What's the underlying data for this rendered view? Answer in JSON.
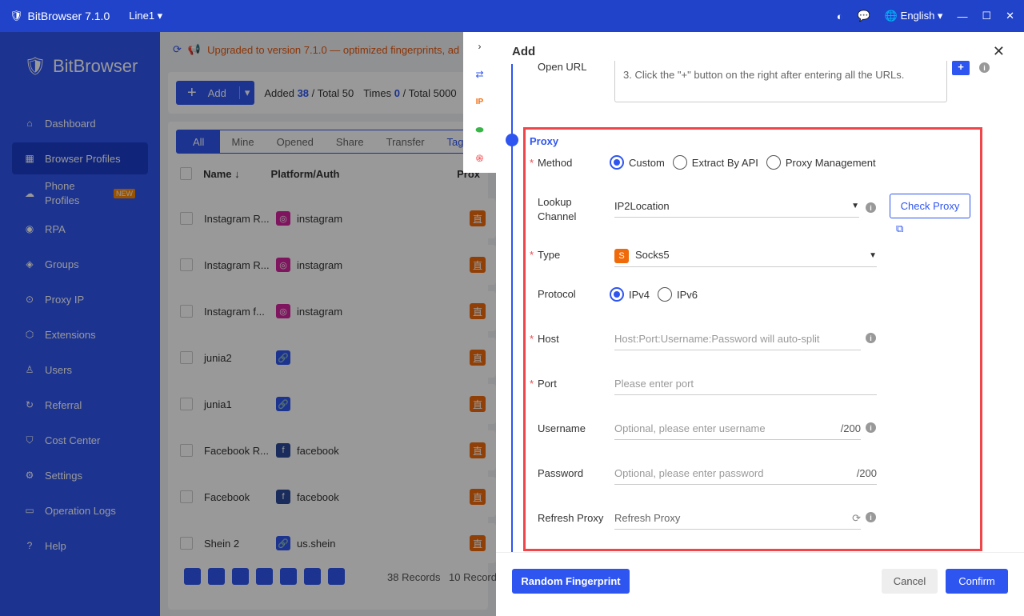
{
  "titlebar": {
    "app": "BitBrowser 7.1.0",
    "line": "Line1 ▾",
    "language": "English ▾"
  },
  "sidebar": {
    "logo": "BitBrowser",
    "items": [
      {
        "label": "Dashboard",
        "icon": "⌂"
      },
      {
        "label": "Browser Profiles",
        "icon": "▦"
      },
      {
        "label": "Phone Profiles",
        "icon": "☁",
        "badge": "NEW"
      },
      {
        "label": "RPA",
        "icon": "◉"
      },
      {
        "label": "Groups",
        "icon": "◈"
      },
      {
        "label": "Proxy IP",
        "icon": "⊙"
      },
      {
        "label": "Extensions",
        "icon": "⬡"
      },
      {
        "label": "Users",
        "icon": "♙"
      },
      {
        "label": "Referral",
        "icon": "↻"
      },
      {
        "label": "Cost Center",
        "icon": "⛉"
      },
      {
        "label": "Settings",
        "icon": "⚙"
      },
      {
        "label": "Operation Logs",
        "icon": "▭"
      },
      {
        "label": "Help",
        "icon": "?"
      }
    ]
  },
  "notice": "Upgraded to version 7.1.0 — optimized fingerprints, ad",
  "toolbar": {
    "add": "Add",
    "added_label": "Added",
    "added": "38",
    "total_label": "/ Total 50",
    "times_label": "Times",
    "times": "0",
    "times_total": "/ Total 5000"
  },
  "tabs": [
    "All",
    "Mine",
    "Opened",
    "Share",
    "Transfer",
    "Tags"
  ],
  "columns": {
    "name": "Name ↓",
    "platform": "Platform/Auth",
    "proxy": "Prox"
  },
  "rows": [
    {
      "name": "Instagram R...",
      "platform": "instagram",
      "type": "ig"
    },
    {
      "name": "Instagram R...",
      "platform": "instagram",
      "type": "ig"
    },
    {
      "name": "Instagram f...",
      "platform": "instagram",
      "type": "ig"
    },
    {
      "name": "junia2",
      "platform": "",
      "type": "link"
    },
    {
      "name": "junia1",
      "platform": "",
      "type": "link"
    },
    {
      "name": "Facebook R...",
      "platform": "facebook",
      "type": "fb"
    },
    {
      "name": "Facebook",
      "platform": "facebook",
      "type": "fb"
    },
    {
      "name": "Shein 2",
      "platform": "us.shein",
      "type": "link"
    }
  ],
  "proxy_badge": "直",
  "records": "38 Records",
  "per_page": "10 Record",
  "drawer": {
    "title": "Add",
    "open_url_label": "Open URL",
    "open_url_hint": "3. Click the \"+\" button on the right after entering all the URLs.",
    "proxy_title": "Proxy",
    "method_label": "Method",
    "methods": [
      "Custom",
      "Extract By API",
      "Proxy Management"
    ],
    "lookup_label": "Lookup Channel",
    "lookup_value": "IP2Location",
    "check_proxy": "Check Proxy",
    "type_label": "Type",
    "type_value": "Socks5",
    "type_icon": "S",
    "protocol_label": "Protocol",
    "protocols": [
      "IPv4",
      "IPv6"
    ],
    "host_label": "Host",
    "host_placeholder": "Host:Port:Username:Password will auto-split",
    "port_label": "Port",
    "port_placeholder": "Please enter port",
    "username_label": "Username",
    "username_placeholder": "Optional, please enter username",
    "username_count": "/200",
    "password_label": "Password",
    "password_placeholder": "Optional, please enter password",
    "password_count": "/200",
    "refresh_label": "Refresh Proxy",
    "refresh_placeholder": "Refresh Proxy",
    "random_fp": "Random Fingerprint",
    "cancel": "Cancel",
    "confirm": "Confirm"
  }
}
